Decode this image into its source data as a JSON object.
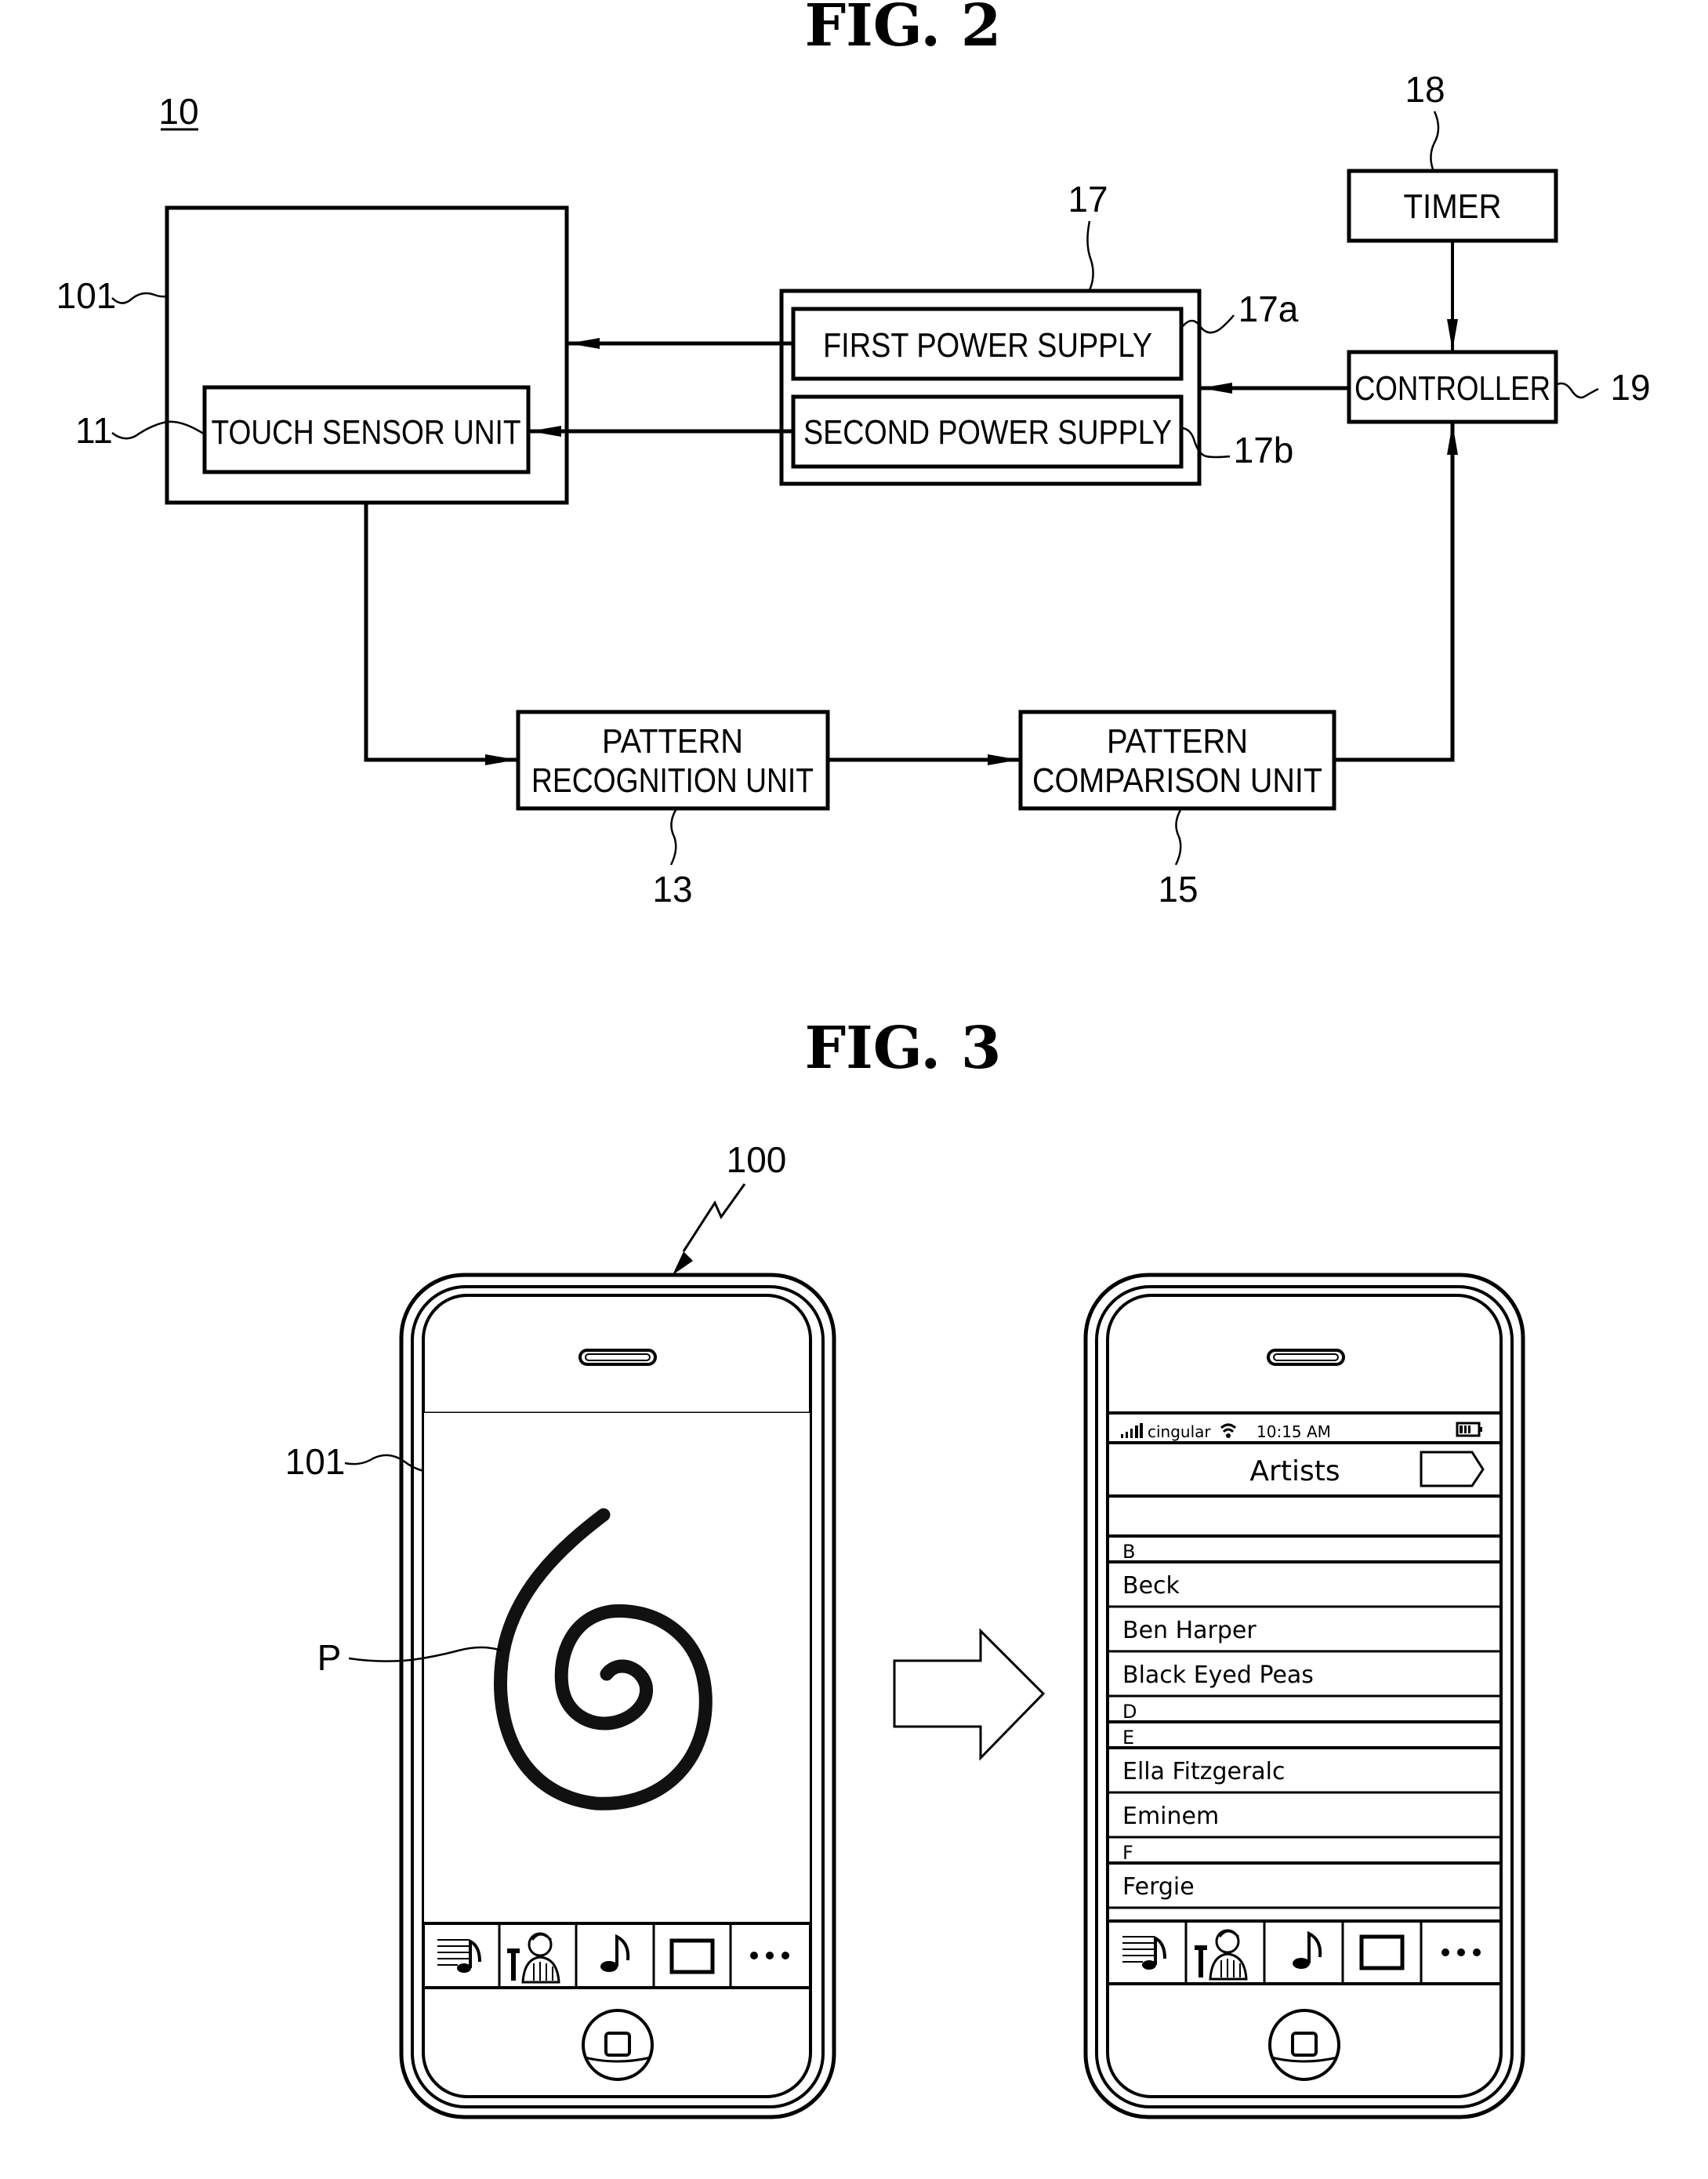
{
  "fig2": {
    "title": "FIG. 2",
    "system_ref": "10",
    "blocks": {
      "display": {
        "ref": "101",
        "label": ""
      },
      "touch_sensor": {
        "ref": "11",
        "label": "TOUCH SENSOR UNIT"
      },
      "power": {
        "ref": "17"
      },
      "first_power": {
        "ref": "17a",
        "label": "FIRST POWER SUPPLY"
      },
      "second_power": {
        "ref": "17b",
        "label": "SECOND POWER SUPPLY"
      },
      "timer": {
        "ref": "18",
        "label": "TIMER"
      },
      "controller": {
        "ref": "19",
        "label": "CONTROLLER"
      },
      "pattern_recognition": {
        "ref": "13",
        "line1": "PATTERN",
        "line2": "RECOGNITION UNIT"
      },
      "pattern_comparison": {
        "ref": "15",
        "line1": "PATTERN",
        "line2": "COMPARISON UNIT"
      }
    }
  },
  "fig3": {
    "title": "FIG. 3",
    "device_ref": "100",
    "display_ref": "101",
    "pattern_ref": "P",
    "right_phone": {
      "status": {
        "carrier": "cingular",
        "time": "10:15 AM"
      },
      "nav_title": "Artists",
      "list": [
        {
          "type": "header",
          "text": "B"
        },
        {
          "type": "item",
          "text": "Beck"
        },
        {
          "type": "item",
          "text": "Ben Harper"
        },
        {
          "type": "item",
          "text": "Black Eyed Peas"
        },
        {
          "type": "header",
          "text": "D"
        },
        {
          "type": "header",
          "text": "E"
        },
        {
          "type": "item",
          "text": "Ella Fitzgeralc"
        },
        {
          "type": "item",
          "text": "Eminem"
        },
        {
          "type": "header",
          "text": "F"
        },
        {
          "type": "item",
          "text": "Fergie"
        }
      ]
    },
    "tabbar_icons": [
      "playlists-icon",
      "artists-icon",
      "songs-icon",
      "videos-icon",
      "more-icon"
    ],
    "more_label": "•••"
  }
}
